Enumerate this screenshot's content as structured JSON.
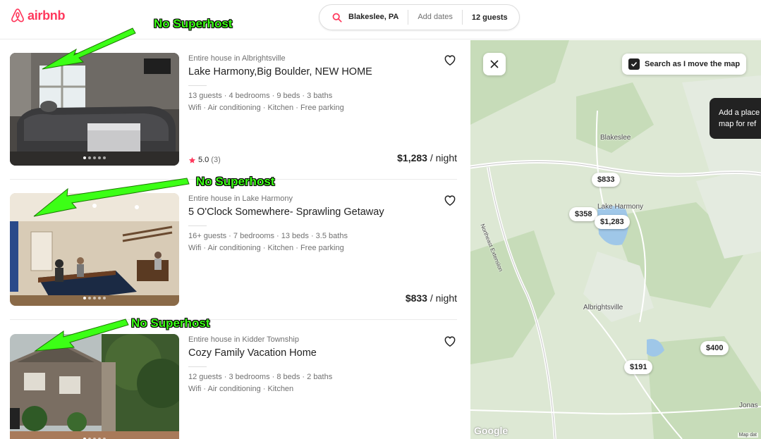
{
  "header": {
    "logo_text": "airbnb",
    "search": {
      "location": "Blakeslee, PA",
      "dates": "Add dates",
      "guests": "12 guests"
    }
  },
  "listings": [
    {
      "subtitle": "Entire house in Albrightsville",
      "title": "Lake Harmony,Big Boulder, NEW HOME",
      "details": "13 guests · 4 bedrooms · 9 beds · 3 baths",
      "amenities": "Wifi · Air conditioning · Kitchen · Free parking",
      "rating": "5.0",
      "reviews": "(3)",
      "price": "$1,283",
      "price_unit": " / night"
    },
    {
      "subtitle": "Entire house in Lake Harmony",
      "title": "5 O'Clock Somewhere- Sprawling Getaway",
      "details": "16+ guests · 7 bedrooms · 13 beds · 3.5 baths",
      "amenities": "Wifi · Air conditioning · Kitchen · Free parking",
      "price": "$833",
      "price_unit": " / night"
    },
    {
      "subtitle": "Entire house in Kidder Township",
      "title": "Cozy Family Vacation Home",
      "details": "12 guests · 3 bedrooms · 8 beds · 2 baths",
      "amenities": "Wifi · Air conditioning · Kitchen"
    }
  ],
  "annotations": [
    "No Superhost",
    "No Superhost",
    "No Superhost"
  ],
  "map": {
    "search_as_move": "Search as I move the map",
    "tooltip_line1": "Add a place",
    "tooltip_line2": "map for ref",
    "pins": [
      "$833",
      "$358",
      "$1,283",
      "$400",
      "$191"
    ],
    "places": [
      "Blakeslee",
      "Lake Harmony",
      "Albrightsville",
      "Jonas",
      "Northeast Extension"
    ],
    "google": "Google",
    "map_data": "Map dat"
  },
  "colors": {
    "brand": "#ff385c",
    "annotation": "#3cff16",
    "map_bg": "#dde8d4"
  }
}
